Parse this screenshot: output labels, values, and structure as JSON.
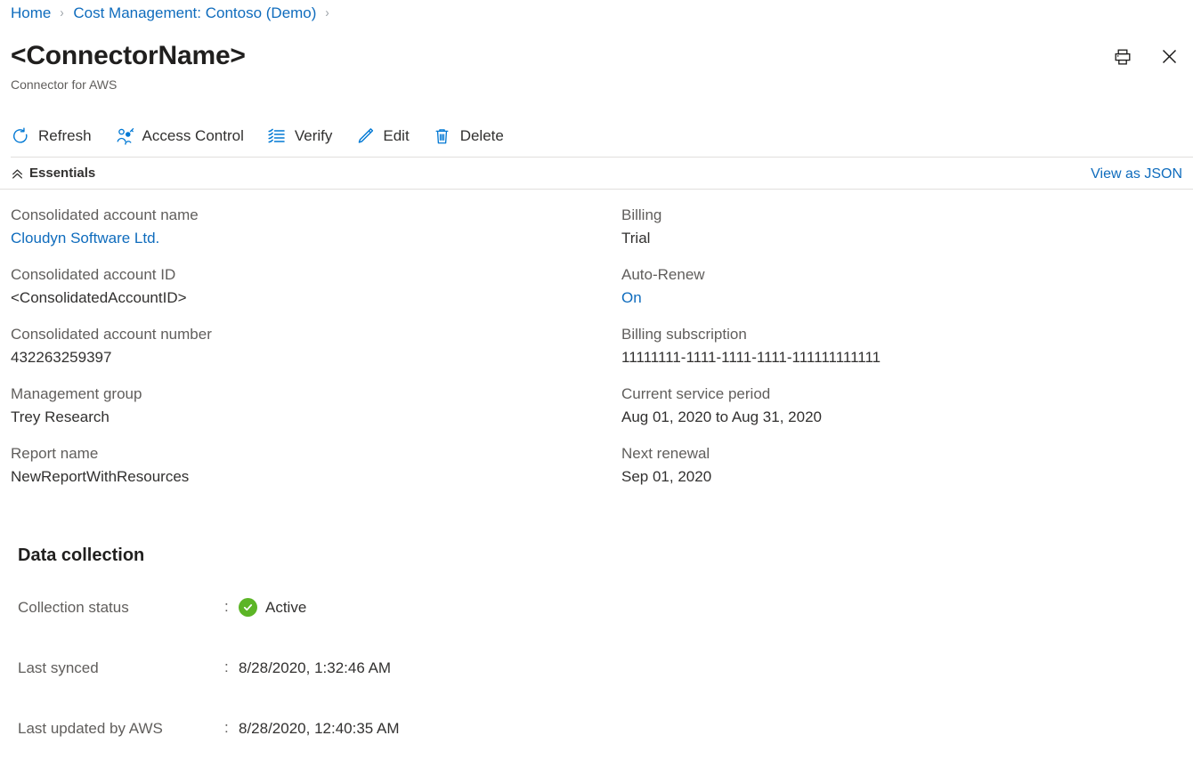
{
  "breadcrumb": {
    "items": [
      {
        "label": "Home"
      },
      {
        "label": "Cost Management: Contoso (Demo)"
      }
    ],
    "separator": "›"
  },
  "header": {
    "title": "<ConnectorName>",
    "subtitle": "Connector for AWS",
    "print_tooltip": "Print",
    "close_tooltip": "Close"
  },
  "commandbar": {
    "items": [
      {
        "label": "Refresh",
        "icon": "refresh-icon"
      },
      {
        "label": "Access Control",
        "icon": "access-control-icon"
      },
      {
        "label": "Verify",
        "icon": "verify-icon"
      },
      {
        "label": "Edit",
        "icon": "edit-icon"
      },
      {
        "label": "Delete",
        "icon": "delete-icon"
      }
    ]
  },
  "essentials": {
    "title": "Essentials",
    "collapse_icon": "double-chevron-up-icon",
    "view_json_label": "View as JSON",
    "left_column": [
      {
        "label": "Consolidated account name",
        "value": "Cloudyn Software Ltd.",
        "is_link": true
      },
      {
        "label": "Consolidated account ID",
        "value": "<ConsolidatedAccountID>",
        "is_link": false
      },
      {
        "label": "Consolidated account number",
        "value": "432263259397",
        "is_link": false
      },
      {
        "label": "Management group",
        "value": "Trey Research",
        "is_link": false
      },
      {
        "label": "Report name",
        "value": "NewReportWithResources",
        "is_link": false
      }
    ],
    "right_column": [
      {
        "label": "Billing",
        "value": "Trial",
        "is_link": false
      },
      {
        "label": "Auto-Renew",
        "value": "On",
        "is_link": true
      },
      {
        "label": "Billing subscription",
        "value": "11111111-1111-1111-1111-111111111111",
        "is_link": false
      },
      {
        "label": "Current service period",
        "value": "Aug 01, 2020 to Aug 31, 2020",
        "is_link": false
      },
      {
        "label": "Next renewal",
        "value": "Sep 01, 2020",
        "is_link": false
      }
    ]
  },
  "data_collection": {
    "title": "Data collection",
    "separator": ":",
    "rows": [
      {
        "label": "Collection status",
        "value": "Active",
        "badge": "success-check-icon"
      },
      {
        "label": "Last synced",
        "value": "8/28/2020, 1:32:46 AM",
        "badge": null
      },
      {
        "label": "Last updated by AWS",
        "value": "8/28/2020, 12:40:35 AM",
        "badge": null
      }
    ]
  },
  "colors": {
    "link": "#0f6cbd",
    "accent": "#0078d4",
    "label": "#605e5c",
    "value": "#323130",
    "success": "#5cb526",
    "divider": "#e1dfdd"
  }
}
